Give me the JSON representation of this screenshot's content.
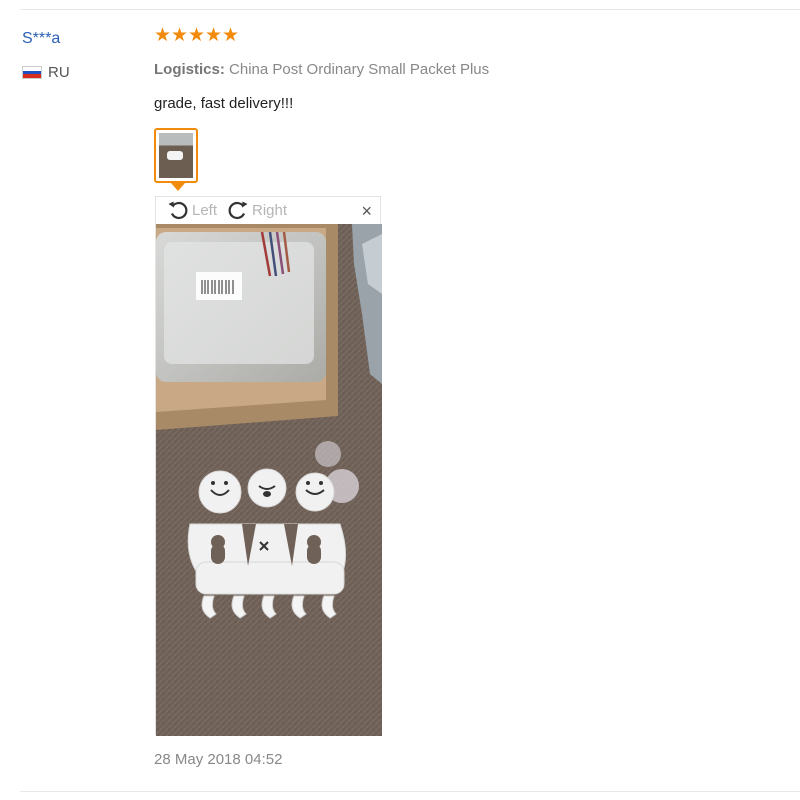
{
  "review": {
    "user": "S***a",
    "country_code": "RU",
    "rating": 5,
    "star_glyph": "★",
    "logistics_label": "Logistics:",
    "logistics_value": "China Post Ordinary Small Packet Plus",
    "text": "grade, fast delivery!!!",
    "date": "28 May 2018 04:52"
  },
  "viewer": {
    "rotate_left_label": "Left",
    "rotate_right_label": "Right",
    "close_glyph": "×"
  },
  "colors": {
    "accent": "#f28b0c",
    "username": "#2b5fb4",
    "flag": [
      "#ffffff",
      "#1c4fbf",
      "#d52b1e"
    ]
  },
  "icons": {
    "rotate_left": "rotate-left-icon",
    "rotate_right": "rotate-right-icon",
    "close": "close-icon",
    "flag": "russia-flag-icon"
  }
}
